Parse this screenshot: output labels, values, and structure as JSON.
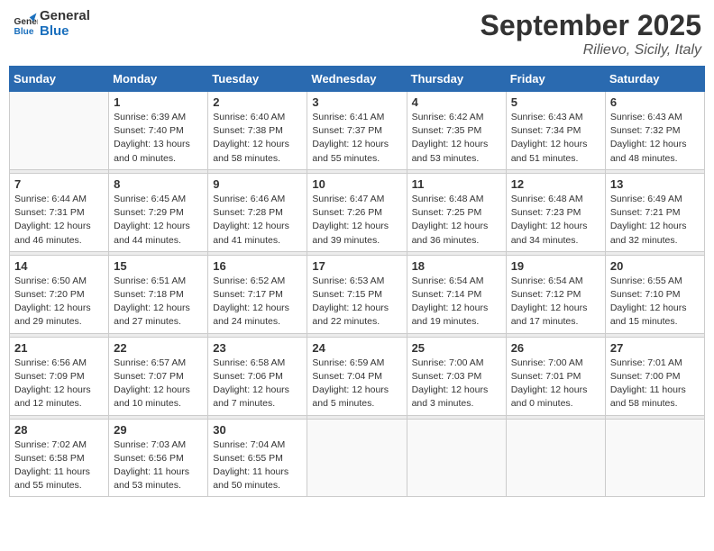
{
  "logo": {
    "line1": "General",
    "line2": "Blue"
  },
  "title": "September 2025",
  "location": "Rilievo, Sicily, Italy",
  "weekdays": [
    "Sunday",
    "Monday",
    "Tuesday",
    "Wednesday",
    "Thursday",
    "Friday",
    "Saturday"
  ],
  "weeks": [
    [
      {
        "day": "",
        "sunrise": "",
        "sunset": "",
        "daylight": ""
      },
      {
        "day": "1",
        "sunrise": "Sunrise: 6:39 AM",
        "sunset": "Sunset: 7:40 PM",
        "daylight": "Daylight: 13 hours and 0 minutes."
      },
      {
        "day": "2",
        "sunrise": "Sunrise: 6:40 AM",
        "sunset": "Sunset: 7:38 PM",
        "daylight": "Daylight: 12 hours and 58 minutes."
      },
      {
        "day": "3",
        "sunrise": "Sunrise: 6:41 AM",
        "sunset": "Sunset: 7:37 PM",
        "daylight": "Daylight: 12 hours and 55 minutes."
      },
      {
        "day": "4",
        "sunrise": "Sunrise: 6:42 AM",
        "sunset": "Sunset: 7:35 PM",
        "daylight": "Daylight: 12 hours and 53 minutes."
      },
      {
        "day": "5",
        "sunrise": "Sunrise: 6:43 AM",
        "sunset": "Sunset: 7:34 PM",
        "daylight": "Daylight: 12 hours and 51 minutes."
      },
      {
        "day": "6",
        "sunrise": "Sunrise: 6:43 AM",
        "sunset": "Sunset: 7:32 PM",
        "daylight": "Daylight: 12 hours and 48 minutes."
      }
    ],
    [
      {
        "day": "7",
        "sunrise": "Sunrise: 6:44 AM",
        "sunset": "Sunset: 7:31 PM",
        "daylight": "Daylight: 12 hours and 46 minutes."
      },
      {
        "day": "8",
        "sunrise": "Sunrise: 6:45 AM",
        "sunset": "Sunset: 7:29 PM",
        "daylight": "Daylight: 12 hours and 44 minutes."
      },
      {
        "day": "9",
        "sunrise": "Sunrise: 6:46 AM",
        "sunset": "Sunset: 7:28 PM",
        "daylight": "Daylight: 12 hours and 41 minutes."
      },
      {
        "day": "10",
        "sunrise": "Sunrise: 6:47 AM",
        "sunset": "Sunset: 7:26 PM",
        "daylight": "Daylight: 12 hours and 39 minutes."
      },
      {
        "day": "11",
        "sunrise": "Sunrise: 6:48 AM",
        "sunset": "Sunset: 7:25 PM",
        "daylight": "Daylight: 12 hours and 36 minutes."
      },
      {
        "day": "12",
        "sunrise": "Sunrise: 6:48 AM",
        "sunset": "Sunset: 7:23 PM",
        "daylight": "Daylight: 12 hours and 34 minutes."
      },
      {
        "day": "13",
        "sunrise": "Sunrise: 6:49 AM",
        "sunset": "Sunset: 7:21 PM",
        "daylight": "Daylight: 12 hours and 32 minutes."
      }
    ],
    [
      {
        "day": "14",
        "sunrise": "Sunrise: 6:50 AM",
        "sunset": "Sunset: 7:20 PM",
        "daylight": "Daylight: 12 hours and 29 minutes."
      },
      {
        "day": "15",
        "sunrise": "Sunrise: 6:51 AM",
        "sunset": "Sunset: 7:18 PM",
        "daylight": "Daylight: 12 hours and 27 minutes."
      },
      {
        "day": "16",
        "sunrise": "Sunrise: 6:52 AM",
        "sunset": "Sunset: 7:17 PM",
        "daylight": "Daylight: 12 hours and 24 minutes."
      },
      {
        "day": "17",
        "sunrise": "Sunrise: 6:53 AM",
        "sunset": "Sunset: 7:15 PM",
        "daylight": "Daylight: 12 hours and 22 minutes."
      },
      {
        "day": "18",
        "sunrise": "Sunrise: 6:54 AM",
        "sunset": "Sunset: 7:14 PM",
        "daylight": "Daylight: 12 hours and 19 minutes."
      },
      {
        "day": "19",
        "sunrise": "Sunrise: 6:54 AM",
        "sunset": "Sunset: 7:12 PM",
        "daylight": "Daylight: 12 hours and 17 minutes."
      },
      {
        "day": "20",
        "sunrise": "Sunrise: 6:55 AM",
        "sunset": "Sunset: 7:10 PM",
        "daylight": "Daylight: 12 hours and 15 minutes."
      }
    ],
    [
      {
        "day": "21",
        "sunrise": "Sunrise: 6:56 AM",
        "sunset": "Sunset: 7:09 PM",
        "daylight": "Daylight: 12 hours and 12 minutes."
      },
      {
        "day": "22",
        "sunrise": "Sunrise: 6:57 AM",
        "sunset": "Sunset: 7:07 PM",
        "daylight": "Daylight: 12 hours and 10 minutes."
      },
      {
        "day": "23",
        "sunrise": "Sunrise: 6:58 AM",
        "sunset": "Sunset: 7:06 PM",
        "daylight": "Daylight: 12 hours and 7 minutes."
      },
      {
        "day": "24",
        "sunrise": "Sunrise: 6:59 AM",
        "sunset": "Sunset: 7:04 PM",
        "daylight": "Daylight: 12 hours and 5 minutes."
      },
      {
        "day": "25",
        "sunrise": "Sunrise: 7:00 AM",
        "sunset": "Sunset: 7:03 PM",
        "daylight": "Daylight: 12 hours and 3 minutes."
      },
      {
        "day": "26",
        "sunrise": "Sunrise: 7:00 AM",
        "sunset": "Sunset: 7:01 PM",
        "daylight": "Daylight: 12 hours and 0 minutes."
      },
      {
        "day": "27",
        "sunrise": "Sunrise: 7:01 AM",
        "sunset": "Sunset: 7:00 PM",
        "daylight": "Daylight: 11 hours and 58 minutes."
      }
    ],
    [
      {
        "day": "28",
        "sunrise": "Sunrise: 7:02 AM",
        "sunset": "Sunset: 6:58 PM",
        "daylight": "Daylight: 11 hours and 55 minutes."
      },
      {
        "day": "29",
        "sunrise": "Sunrise: 7:03 AM",
        "sunset": "Sunset: 6:56 PM",
        "daylight": "Daylight: 11 hours and 53 minutes."
      },
      {
        "day": "30",
        "sunrise": "Sunrise: 7:04 AM",
        "sunset": "Sunset: 6:55 PM",
        "daylight": "Daylight: 11 hours and 50 minutes."
      },
      {
        "day": "",
        "sunrise": "",
        "sunset": "",
        "daylight": ""
      },
      {
        "day": "",
        "sunrise": "",
        "sunset": "",
        "daylight": ""
      },
      {
        "day": "",
        "sunrise": "",
        "sunset": "",
        "daylight": ""
      },
      {
        "day": "",
        "sunrise": "",
        "sunset": "",
        "daylight": ""
      }
    ]
  ]
}
